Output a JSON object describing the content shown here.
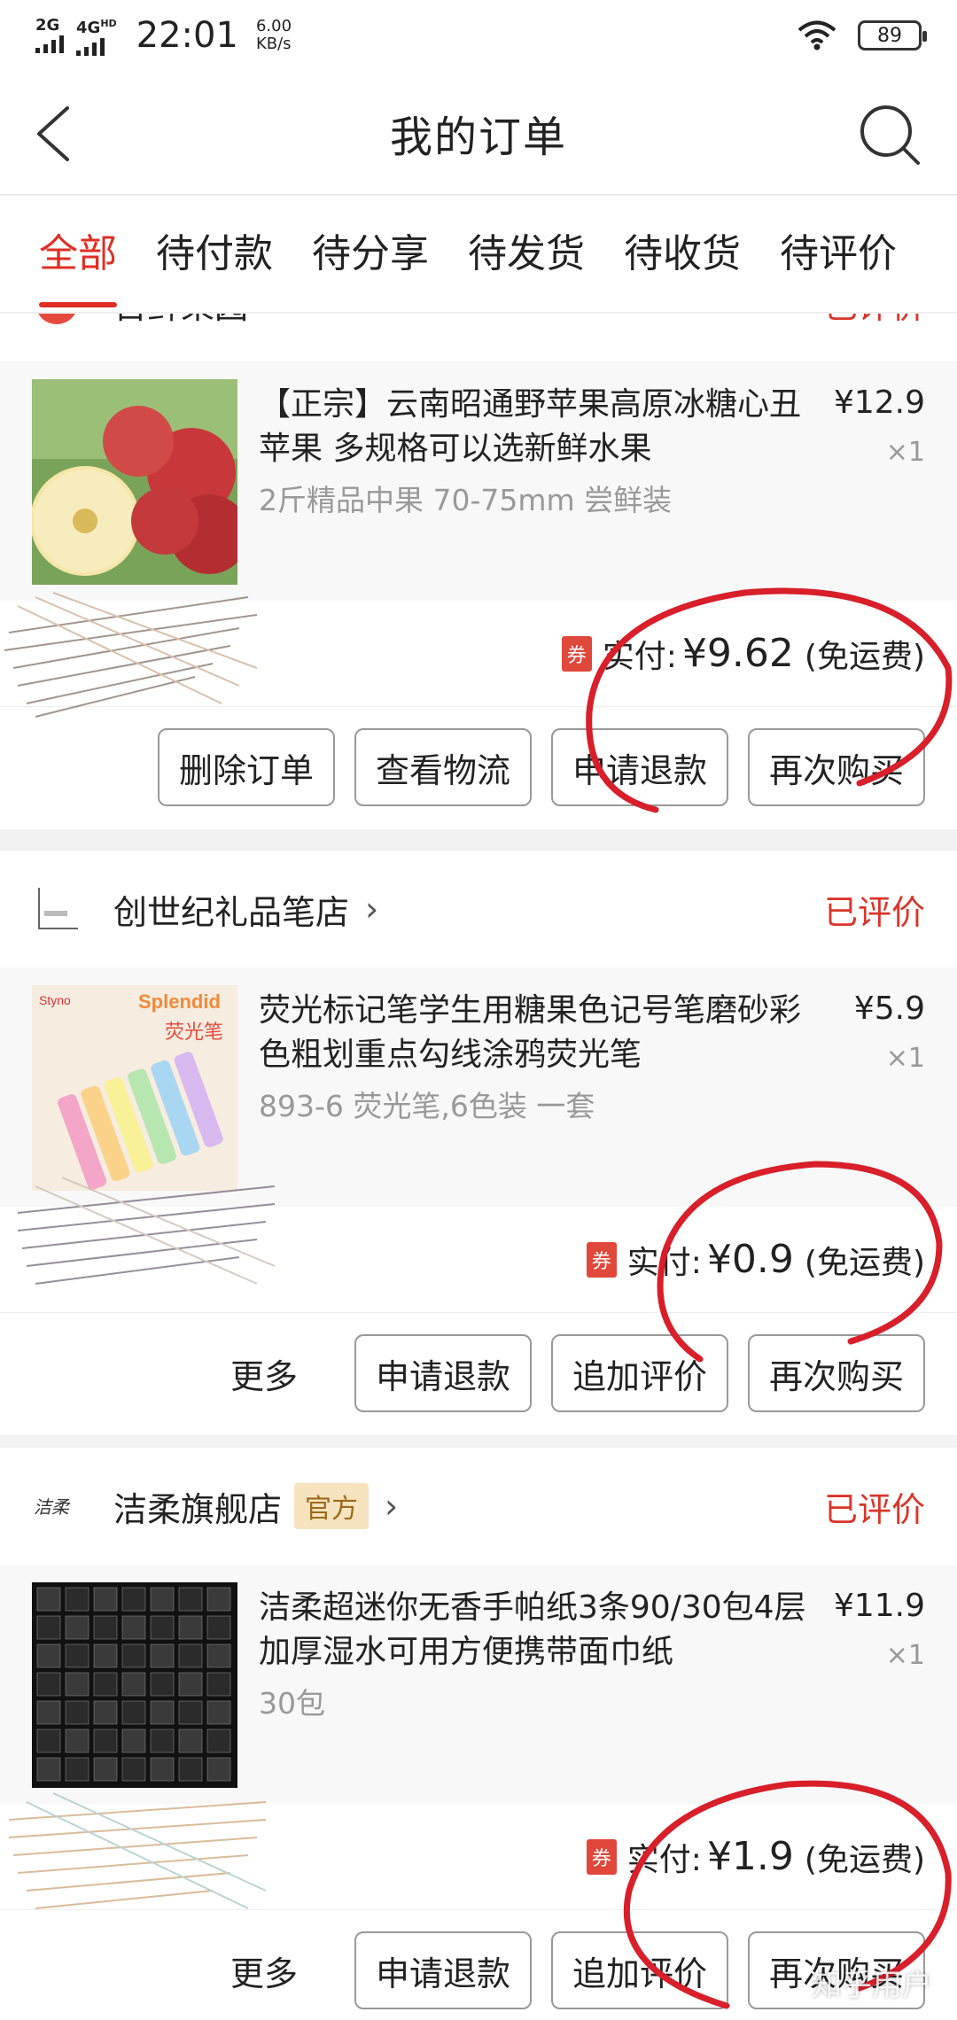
{
  "status_bar": {
    "network1": "2G",
    "network2": "4G",
    "network2_sup": "HD",
    "time": "22:01",
    "speed_value": "6.00",
    "speed_unit": "KB/s",
    "battery": "89"
  },
  "header": {
    "title": "我的订单"
  },
  "tabs": [
    {
      "label": "全部",
      "active": true
    },
    {
      "label": "待付款"
    },
    {
      "label": "待分享"
    },
    {
      "label": "待发货"
    },
    {
      "label": "待收货"
    },
    {
      "label": "待评价"
    }
  ],
  "orders": [
    {
      "shop": "百鲜果园",
      "status": "已评价",
      "item_name": "【正宗】云南昭通野苹果高原冰糖心丑苹果 多规格可以选新鲜水果",
      "item_spec": "2斤精品中果 70-75mm 尝鲜装",
      "price": "¥12.9",
      "qty": "×1",
      "pay_label": "实付:",
      "pay_amount": "¥9.62",
      "shipping": "(免运费)",
      "coupon": "券",
      "buttons": [
        "删除订单",
        "查看物流",
        "申请退款",
        "再次购买"
      ]
    },
    {
      "shop": "创世纪礼品笔店",
      "status": "已评价",
      "item_name": "荧光标记笔学生用糖果色记号笔磨砂彩色粗划重点勾线涂鸦荧光笔",
      "item_spec": "893-6 荧光笔,6色装 一套",
      "price": "¥5.9",
      "qty": "×1",
      "pay_label": "实付:",
      "pay_amount": "¥0.9",
      "shipping": "(免运费)",
      "coupon": "券",
      "more": "更多",
      "buttons": [
        "申请退款",
        "追加评价",
        "再次购买"
      ]
    },
    {
      "shop": "洁柔旗舰店",
      "official": "官方",
      "status": "已评价",
      "item_name": "洁柔超迷你无香手帕纸3条90/30包4层加厚湿水可用方便携带面巾纸",
      "item_spec": "30包",
      "price": "¥11.9",
      "qty": "×1",
      "pay_label": "实付:",
      "pay_amount": "¥1.9",
      "shipping": "(免运费)",
      "coupon": "券",
      "more": "更多",
      "buttons": [
        "申请退款",
        "追加评价",
        "再次购买"
      ]
    }
  ],
  "watermark": "知乎用户",
  "colors": {
    "accent": "#e02e24",
    "marker": "#d81f2a"
  },
  "icons": {
    "back": "chevron-left-icon",
    "search": "search-icon",
    "wifi": "wifi-icon",
    "chevron": "chevron-right-icon"
  }
}
